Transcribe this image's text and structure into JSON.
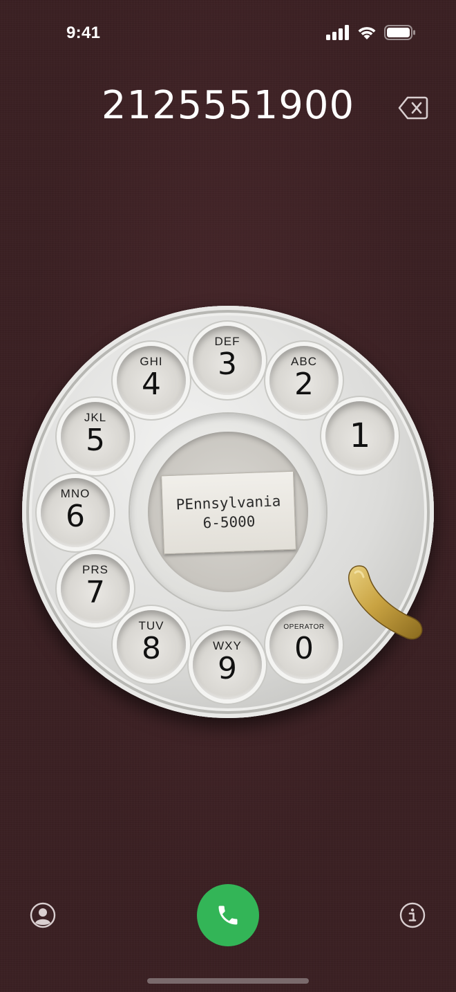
{
  "status_bar": {
    "time": "9:41"
  },
  "dialer": {
    "number": "2125551900"
  },
  "dial": {
    "holes": [
      {
        "digit": "1",
        "letters": ""
      },
      {
        "digit": "2",
        "letters": "ABC"
      },
      {
        "digit": "3",
        "letters": "DEF"
      },
      {
        "digit": "4",
        "letters": "GHI"
      },
      {
        "digit": "5",
        "letters": "JKL"
      },
      {
        "digit": "6",
        "letters": "MNO"
      },
      {
        "digit": "7",
        "letters": "PRS"
      },
      {
        "digit": "8",
        "letters": "TUV"
      },
      {
        "digit": "9",
        "letters": "WXY"
      },
      {
        "digit": "0",
        "letters": "OPERATOR"
      }
    ],
    "card": {
      "line1": "PEnnsylvania",
      "line2": "6-5000"
    }
  },
  "colors": {
    "background": "#3a1f22",
    "call_button": "#33b557",
    "finger_stop": "#b8932e"
  },
  "icons": {
    "backspace": "delete-left-icon",
    "contacts": "person-circle-icon",
    "call": "phone-icon",
    "info": "info-circle-icon"
  }
}
